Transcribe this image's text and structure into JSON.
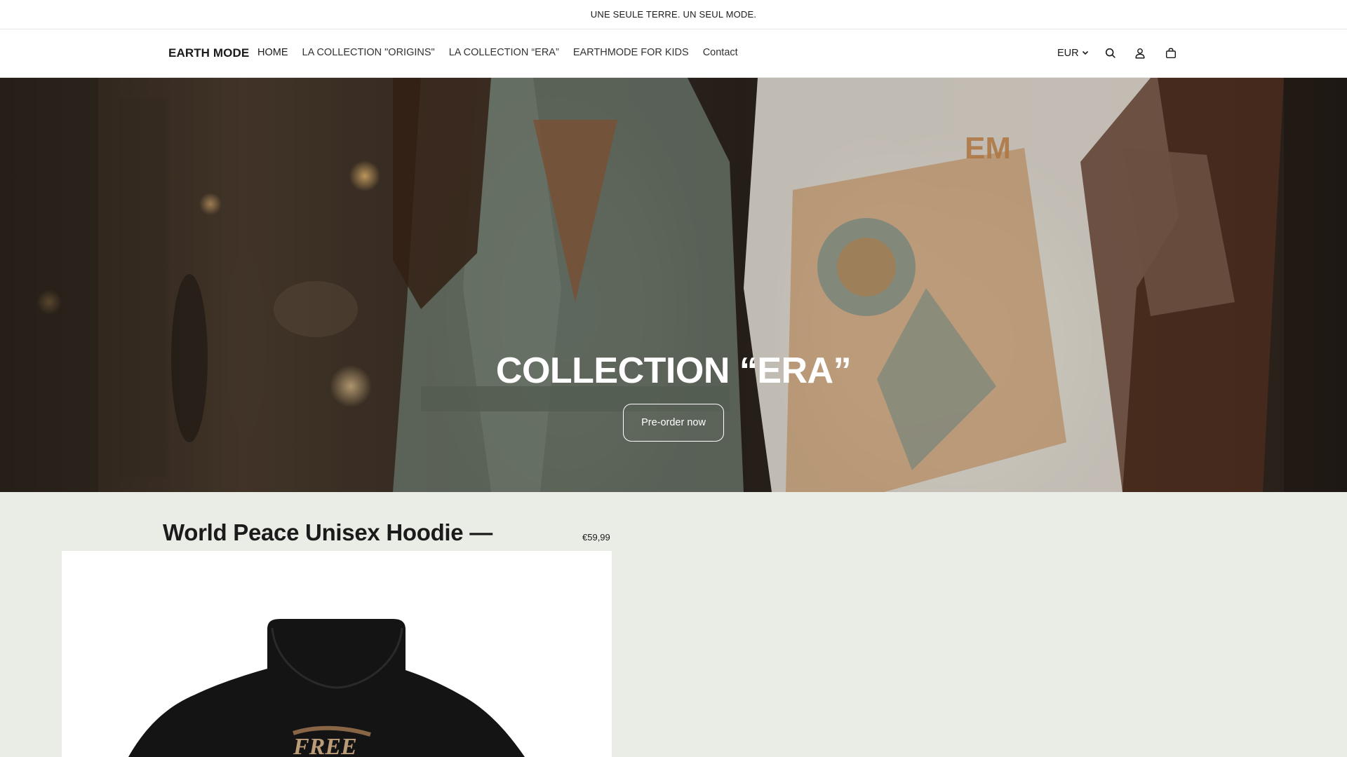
{
  "announcement": {
    "text": "UNE SEULE TERRE. UN SEUL MODE."
  },
  "header": {
    "logo": "EARTH MODE",
    "nav": [
      {
        "label": "HOME"
      },
      {
        "label": "LA COLLECTION \"ORIGINS\""
      },
      {
        "label": "LA COLLECTION “ERA”"
      },
      {
        "label": "EARTHMODE FOR KIDS"
      },
      {
        "label": "Contact"
      }
    ],
    "currency": "EUR",
    "icons": [
      "chevron-down-icon",
      "search-icon",
      "account-icon",
      "cart-icon"
    ]
  },
  "hero": {
    "title": "COLLECTION “ERA”",
    "button_label": "Pre-order now"
  },
  "product": {
    "title": "World Peace Unisex Hoodie —",
    "price": "€59,99"
  },
  "colors": {
    "page_background": "#eaede5",
    "header_background": "#ffffff",
    "text": "#1b1b1b",
    "hero_text": "#ffffff"
  }
}
